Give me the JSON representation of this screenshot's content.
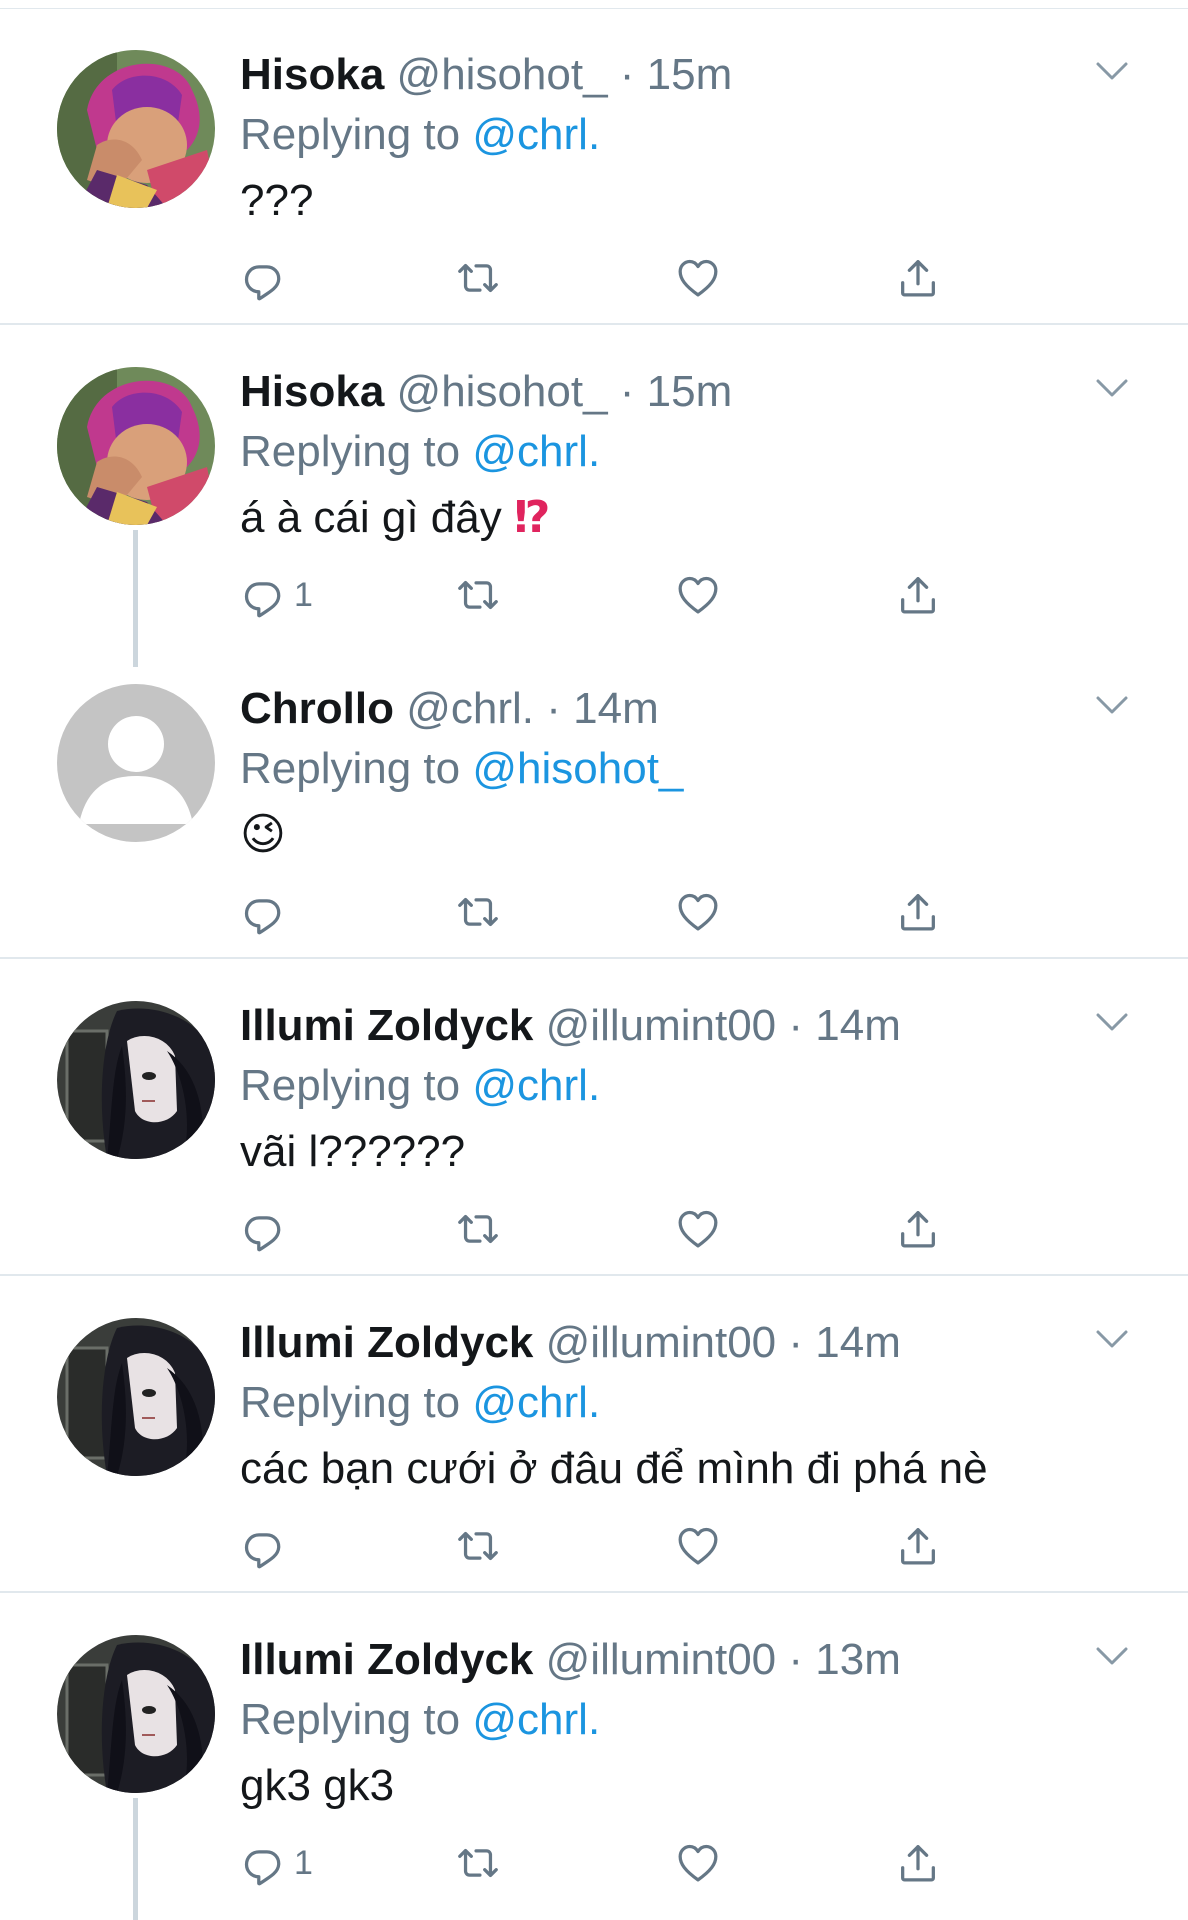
{
  "tweets": [
    {
      "name": "Hisoka",
      "handle": "@hisohot_",
      "time": "15m",
      "replying_label": "Replying to",
      "replying_to": "@chrl.",
      "text": "???",
      "reply_count": "",
      "avatar": "hisoka-avatar"
    },
    {
      "name": "Hisoka",
      "handle": "@hisohot_",
      "time": "15m",
      "replying_label": "Replying to",
      "replying_to": "@chrl.",
      "text": "á à cái gì đây",
      "emoji": "⁉",
      "reply_count": "1",
      "avatar": "hisoka-avatar"
    },
    {
      "name": "Chrollo",
      "handle": "@chrl.",
      "time": "14m",
      "replying_label": "Replying to",
      "replying_to": "@hisohot_",
      "text": "😉",
      "reply_count": "",
      "avatar": "default-avatar"
    },
    {
      "name": "Illumi Zoldyck",
      "handle": "@illumint00",
      "time": "14m",
      "replying_label": "Replying to",
      "replying_to": "@chrl.",
      "text": "vãi l??????",
      "reply_count": "",
      "avatar": "illumi-avatar"
    },
    {
      "name": "Illumi Zoldyck",
      "handle": "@illumint00",
      "time": "14m",
      "replying_label": "Replying to",
      "replying_to": "@chrl.",
      "text": "các bạn cưới ở đâu để mình đi phá nè",
      "reply_count": "",
      "avatar": "illumi-avatar"
    },
    {
      "name": "Illumi Zoldyck",
      "handle": "@illumint00",
      "time": "13m",
      "replying_label": "Replying to",
      "replying_to": "@chrl.",
      "text": "gk3 gk3",
      "reply_count": "1",
      "avatar": "illumi-avatar"
    }
  ],
  "separator": " · ",
  "icons": {
    "reply": "reply-icon",
    "retweet": "retweet-icon",
    "like": "heart-icon",
    "share": "share-icon",
    "more": "chevron-down-icon"
  },
  "colors": {
    "link": "#1b95e0",
    "meta": "#657786",
    "name": "#14171a",
    "divider": "#e1e8ed",
    "thread": "#ccd6dd",
    "alert": "#e0245e"
  }
}
